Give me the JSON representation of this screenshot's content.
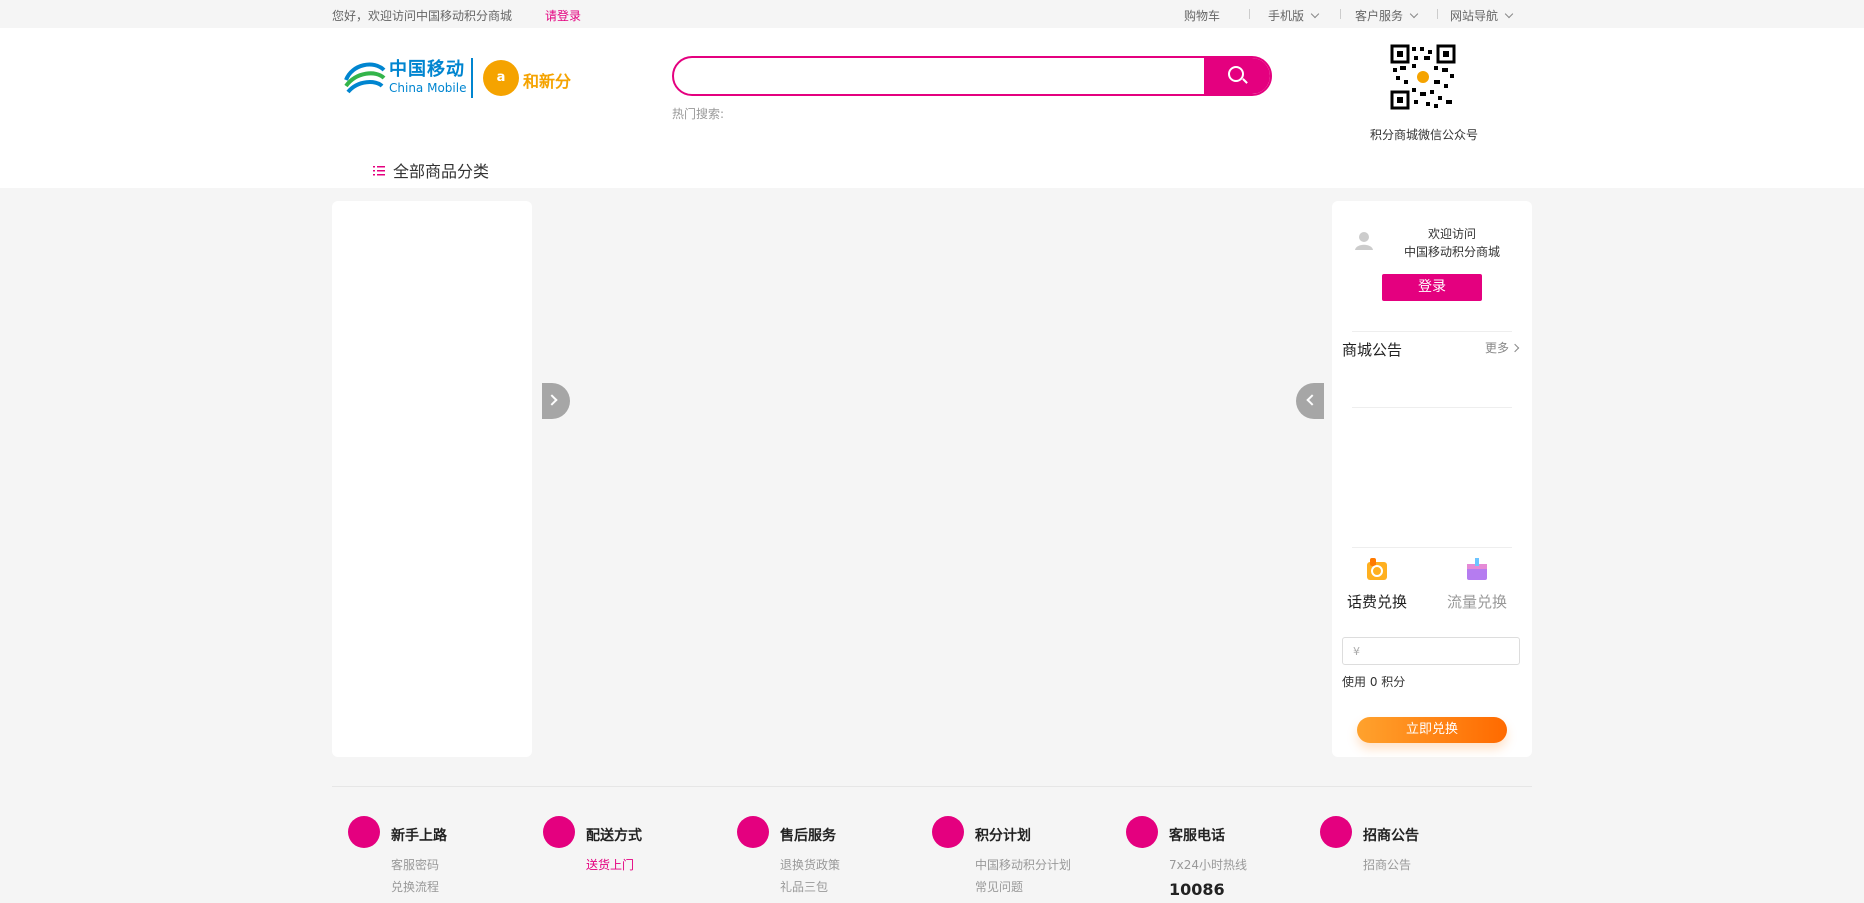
{
  "topbar": {
    "welcome": "您好，欢迎访问中国移动积分商城",
    "login_link": "请登录",
    "cart": "购物车",
    "mobile": "手机版",
    "service": "客户服务",
    "sitenav": "网站导航"
  },
  "header": {
    "logo_cn": "中国移动",
    "logo_en": "China Mobile",
    "logo_he_mark": "a",
    "logo_he_text": "和新分",
    "search_placeholder": "",
    "hot_search": "热门搜索:",
    "qr_label": "积分商城微信公众号",
    "all_categories": "全部商品分类"
  },
  "user_panel": {
    "welcome_line1": "欢迎访问",
    "welcome_line2": "中国移动积分商城",
    "login_button": "登录",
    "notice_title": "商城公告",
    "notice_more": "更多",
    "tab_fee": "话费兑换",
    "tab_flow": "流量兑换",
    "currency_symbol": "¥",
    "use_points": "使用 0 积分",
    "exchange_button": "立即兑换"
  },
  "footer": {
    "columns": [
      {
        "title": "新手上路",
        "links": [
          "客服密码",
          "兑换流程"
        ]
      },
      {
        "title": "配送方式",
        "links": [
          "送货上门"
        ]
      },
      {
        "title": "售后服务",
        "links": [
          "退换货政策",
          "礼品三包"
        ]
      },
      {
        "title": "积分计划",
        "links": [
          "中国移动积分计划",
          "常见问题"
        ]
      },
      {
        "title": "客服电话",
        "links": [
          "7x24小时热线"
        ],
        "hotline": "10086"
      },
      {
        "title": "招商公告",
        "links": [
          "招商公告"
        ]
      }
    ]
  },
  "colors": {
    "brand_pink": "#e4007f",
    "cm_blue": "#0085d0",
    "he_orange": "#f5a300",
    "exchange_orange": "#ff8a20"
  },
  "icons": {
    "search": "search-icon",
    "chevron": "chevron-down-icon",
    "category": "list-icon",
    "avatar": "user-avatar-icon",
    "arrow_left": "chevron-left-icon",
    "arrow_right": "chevron-right-icon"
  }
}
